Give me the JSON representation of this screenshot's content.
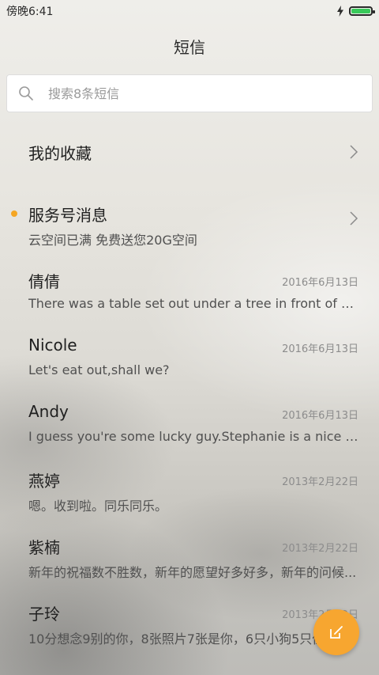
{
  "status_bar": {
    "time": "傍晚6:41",
    "icons": [
      "charging-icon",
      "battery-icon"
    ],
    "battery_level": 1.0,
    "battery_color": "#39c95a"
  },
  "header": {
    "title": "短信"
  },
  "search": {
    "placeholder": "搜索8条短信"
  },
  "conversations": [
    {
      "title": "我的收藏",
      "type": "folder"
    },
    {
      "title": "服务号消息",
      "preview": "云空间已满 免费送您20G空间",
      "unread": true,
      "type": "folder"
    },
    {
      "title": "倩倩",
      "date": "2016年6月13日",
      "preview": "There was a table set out under a tree in front of the ho..."
    },
    {
      "title": "Nicole",
      "date": "2016年6月13日",
      "preview": "Let's eat out,shall we?"
    },
    {
      "title": "Andy",
      "date": "2016年6月13日",
      "preview": "I guess you're some lucky guy.Stephanie is a nice girl."
    },
    {
      "title": "燕婷",
      "date": "2013年2月22日",
      "preview": "嗯。收到啦。同乐同乐。"
    },
    {
      "title": "紫楠",
      "date": "2013年2月22日",
      "preview": "新年的祝福数不胜数，新年的愿望好多好多，新年的问候..."
    },
    {
      "title": "子玲",
      "date": "2013年2月22日",
      "preview": "10分想念9别的你，8张照片7张是你，6只小狗5只像你..."
    }
  ],
  "fab": {
    "icon": "compose-icon",
    "color": "#f7a630"
  },
  "colors": {
    "unread_dot": "#f5a623"
  }
}
